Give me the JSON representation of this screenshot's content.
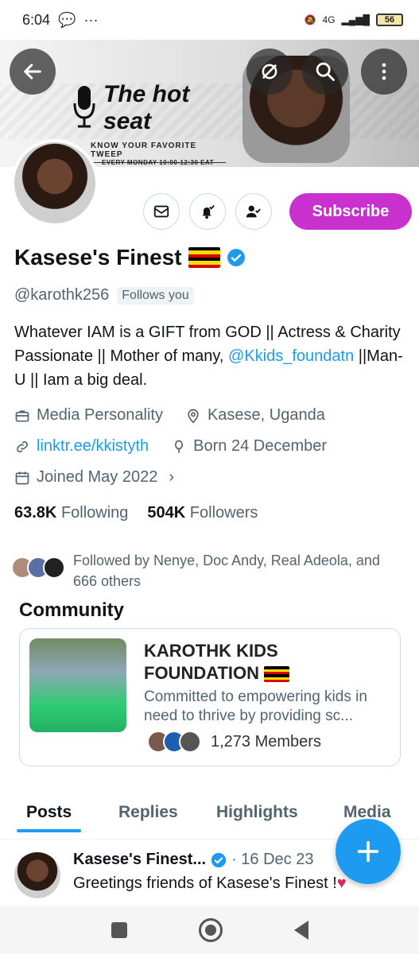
{
  "status_bar": {
    "time": "6:04",
    "network": "4G",
    "battery": "56"
  },
  "banner": {
    "title_line1": "The hot",
    "title_line2": "seat",
    "subtitle": "KNOW YOUR FAVORITE TWEEP",
    "schedule": "EVERY MONDAY 10:00-12:30 EAT"
  },
  "profile": {
    "display_name": "Kasese's Finest",
    "handle": "@karothk256",
    "follows_you": "Follows you",
    "bio_part1": "Whatever IAM is a GIFT from GOD || Actress & Charity Passionate || Mother of many, ",
    "bio_link": "@Kkids_foundatn",
    "bio_part2": " ||Man-U || Iam a big deal.",
    "category": "Media Personality",
    "location": "Kasese, Uganda",
    "website": "linktr.ee/kkistyth",
    "birthday": "Born 24 December",
    "joined": "Joined May 2022",
    "following_count": "63.8K",
    "following_label": "Following",
    "followers_count": "504K",
    "followers_label": "Followers",
    "followed_by": "Followed by Nenye, Doc Andy, Real Adeola, and 666 others"
  },
  "actions": {
    "subscribe_label": "Subscribe"
  },
  "community": {
    "heading": "Community",
    "name": "KAROTHK KIDS FOUNDATION",
    "description": "Committed to empowering kids in need to thrive by providing sc...",
    "members": "1,273 Members"
  },
  "tabs": [
    "Posts",
    "Replies",
    "Highlights",
    "Media"
  ],
  "post": {
    "name": "Kasese's Finest...",
    "date": "· 16 Dec 23",
    "text": "Greetings friends of Kasese's Finest !"
  },
  "colors": {
    "accent": "#1d9bf0",
    "subscribe": "#c931cf",
    "secondary_text": "#536471"
  }
}
